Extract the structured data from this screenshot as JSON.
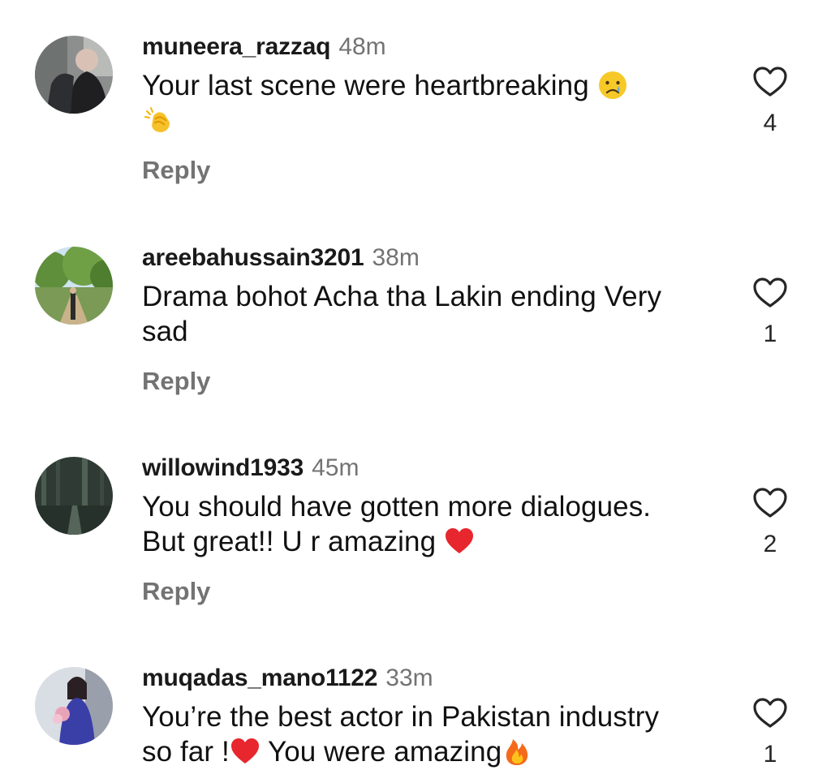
{
  "comments": [
    {
      "username": "muneera_razzaq",
      "time": "48m",
      "text_line1": "Your last scene were heartbreaking ",
      "emoji1": "crying-face-emoji",
      "emoji2": "clapping-hands-emoji",
      "reply_label": "Reply",
      "likes": "4"
    },
    {
      "username": "areebahussain3201",
      "time": "38m",
      "text_line1": "Drama bohot Acha tha Lakin ending Very",
      "text_line2": "sad",
      "reply_label": "Reply",
      "likes": "1"
    },
    {
      "username": "willowind1933",
      "time": "45m",
      "text_line1": "You should have gotten more dialogues.",
      "text_line2": "But great!! U r amazing ",
      "emoji1": "red-heart-emoji",
      "reply_label": "Reply",
      "likes": "2"
    },
    {
      "username": "muqadas_mano1122",
      "time": "33m",
      "text_line1": "You’re the best actor in Pakistan industry",
      "text_line2_a": "so far !",
      "text_line2_b": " You were amazing",
      "emoji1": "red-heart-emoji",
      "emoji2": "fire-emoji",
      "likes": "1"
    }
  ],
  "colors": {
    "username": "#1a1a1a",
    "secondary_text": "#737373",
    "body_text": "#111111",
    "heart_outline": "#262626"
  }
}
